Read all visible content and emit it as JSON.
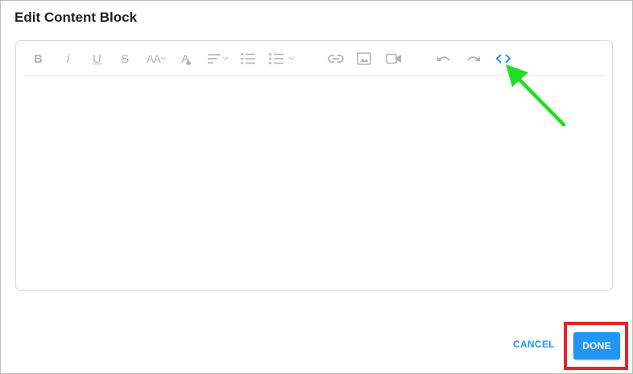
{
  "dialog": {
    "title": "Edit Content Block"
  },
  "toolbar": {
    "items": [
      {
        "name": "bold-button",
        "label": "B"
      },
      {
        "name": "italic-button",
        "label": "i"
      },
      {
        "name": "underline-button",
        "label": "U"
      },
      {
        "name": "strikethrough-button",
        "label": "S"
      },
      {
        "name": "font-size-button",
        "label": "AA"
      },
      {
        "name": "text-color-button",
        "label": "A"
      },
      {
        "name": "align-button",
        "icon": "align-left-icon"
      },
      {
        "name": "ordered-list-button",
        "icon": "ordered-list-icon"
      },
      {
        "name": "unordered-list-button",
        "icon": "unordered-list-icon"
      },
      {
        "name": "link-button",
        "icon": "link-icon"
      },
      {
        "name": "image-button",
        "icon": "image-icon"
      },
      {
        "name": "video-button",
        "icon": "video-icon"
      },
      {
        "name": "undo-button",
        "icon": "undo-icon"
      },
      {
        "name": "redo-button",
        "icon": "redo-icon"
      },
      {
        "name": "code-view-button",
        "icon": "code-icon"
      }
    ],
    "active_color": "#2196f3",
    "inactive_color": "#b3b3b3"
  },
  "editor": {
    "content": ""
  },
  "footer": {
    "cancel_label": "CANCEL",
    "done_label": "DONE"
  },
  "annotations": {
    "arrow_color": "#22dd22",
    "highlight_color": "#e3242b"
  }
}
